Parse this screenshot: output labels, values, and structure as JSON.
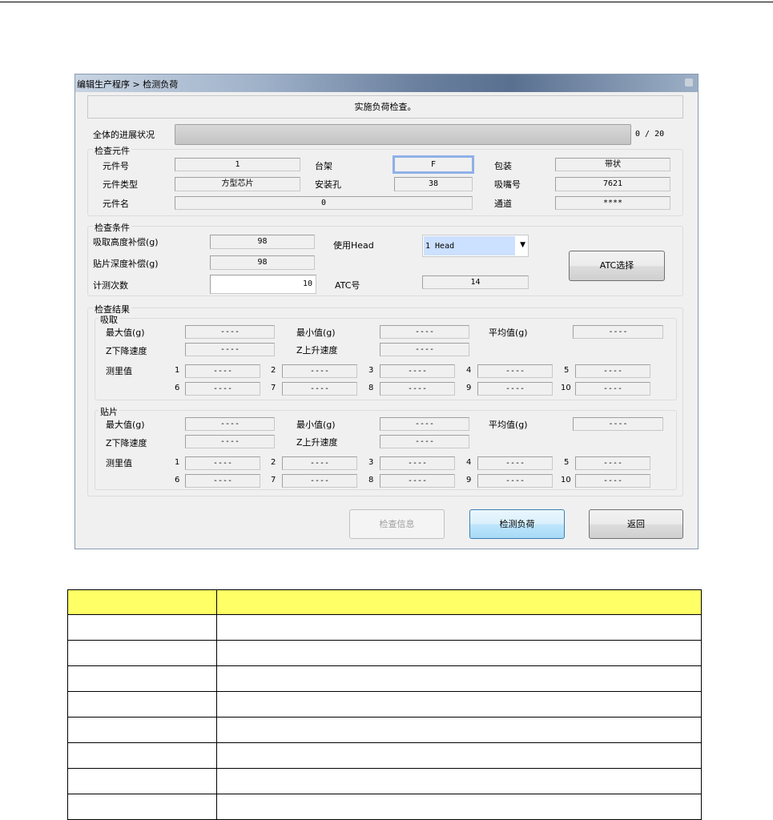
{
  "window": {
    "title": "编辑生产程序 > 检测负荷",
    "message": "实施负荷检查。"
  },
  "progress": {
    "label": "全体的进展状况",
    "value": 0,
    "total": 20,
    "text": "0 / 20"
  },
  "component": {
    "group": "检查元件",
    "part_no_label": "元件号",
    "part_no": "1",
    "feeder_label": "台架",
    "feeder": "F",
    "package_label": "包装",
    "package": "带状",
    "type_label": "元件类型",
    "type": "方型芯片",
    "slot_label": "安装孔",
    "slot": "38",
    "nozzle_label": "吸嘴号",
    "nozzle": "7621",
    "name_label": "元件名",
    "name": "0",
    "lane_label": "通道",
    "lane": "****"
  },
  "conditions": {
    "group": "检查条件",
    "pick_label": "吸取高度补偿(g)",
    "pick": "98",
    "place_label": "贴片深度补偿(g)",
    "place": "98",
    "count_label": "计测次数",
    "count": "10",
    "head_label": "使用Head",
    "head": "1 Head",
    "atc_label": "ATC号",
    "atc": "14",
    "atc_button": "ATC选择"
  },
  "results": {
    "group": "检查结果",
    "pick": {
      "title": "吸取",
      "max_label": "最大值(g)",
      "max": "----",
      "min_label": "最小值(g)",
      "min": "----",
      "avg_label": "平均值(g)",
      "avg": "----",
      "zdown_label": "Z下降速度",
      "zdown": "----",
      "zup_label": "Z上升速度",
      "zup": "----",
      "meas_label": "测里值",
      "values": [
        "----",
        "----",
        "----",
        "----",
        "----",
        "----",
        "----",
        "----",
        "----",
        "----"
      ],
      "indices": [
        "1",
        "2",
        "3",
        "4",
        "5",
        "6",
        "7",
        "8",
        "9",
        "10"
      ]
    },
    "place": {
      "title": "贴片",
      "max_label": "最大值(g)",
      "max": "----",
      "min_label": "最小值(g)",
      "min": "----",
      "avg_label": "平均值(g)",
      "avg": "----",
      "zdown_label": "Z下降速度",
      "zdown": "----",
      "zup_label": "Z上升速度",
      "zup": "----",
      "meas_label": "测里值",
      "values": [
        "----",
        "----",
        "----",
        "----",
        "----",
        "----",
        "----",
        "----",
        "----",
        "----"
      ],
      "indices": [
        "1",
        "2",
        "3",
        "4",
        "5",
        "6",
        "7",
        "8",
        "9",
        "10"
      ]
    }
  },
  "buttons": {
    "info": "检查信息",
    "measure": "检测负荷",
    "back": "返回"
  },
  "colors": {
    "table_header": "#ffff66",
    "focus": "#8fb0e8",
    "select_bg": "#cce0ff"
  }
}
